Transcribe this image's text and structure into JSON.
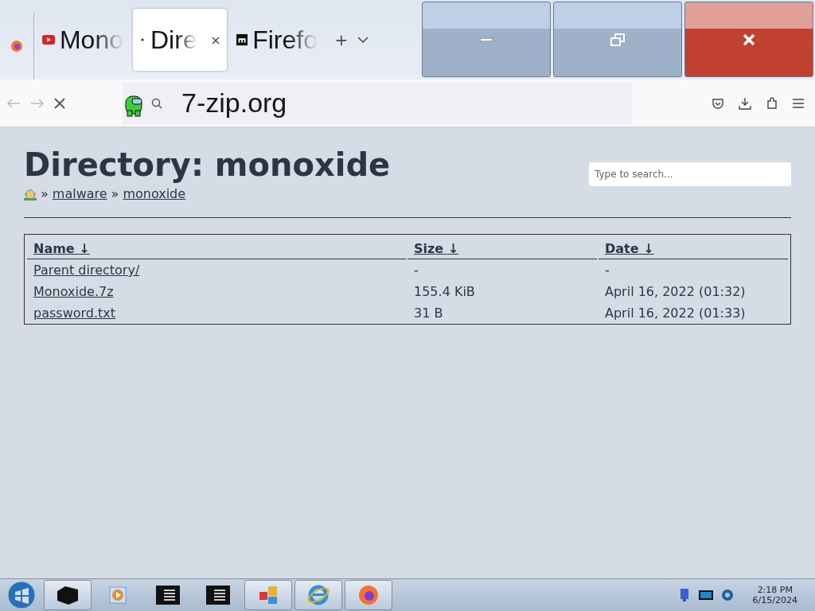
{
  "tabs": [
    {
      "label": "Mono",
      "kind": "video",
      "selected": false
    },
    {
      "label": "Dire",
      "kind": "page",
      "selected": true,
      "close": "×"
    },
    {
      "label": "Firefo",
      "kind": "site",
      "selected": false
    }
  ],
  "new_tab": "+",
  "url": "7-zip.org",
  "page": {
    "title": "Directory: monoxide",
    "breadcrumb": [
      "malware",
      "monoxide"
    ],
    "separator": "»",
    "search": {
      "placeholder": "Type to search..."
    },
    "table": {
      "columns": [
        {
          "label": "Name",
          "sort": "↓"
        },
        {
          "label": "Size",
          "sort": "↓"
        },
        {
          "label": "Date",
          "sort": "↓"
        }
      ],
      "rows": [
        [
          "Parent directory/",
          "-",
          "-"
        ],
        [
          "Monoxide.7z",
          "155.4 KiB",
          "April 16, 2022 (01:32)"
        ],
        [
          "password.txt",
          "31 B",
          "April 16, 2022 (01:33)"
        ]
      ]
    }
  },
  "taskbar": {
    "items": [
      {
        "kind": "box",
        "highlighted": true
      },
      {
        "kind": "player",
        "highlighted": false
      },
      {
        "kind": "console",
        "highlighted": false
      },
      {
        "kind": "console",
        "highlighted": false
      },
      {
        "kind": "tiles",
        "highlighted": true
      },
      {
        "kind": "ie",
        "highlighted": true
      },
      {
        "kind": "firefox",
        "highlighted": true
      }
    ],
    "time": "2:18 PM",
    "date": "6/15/2024"
  }
}
